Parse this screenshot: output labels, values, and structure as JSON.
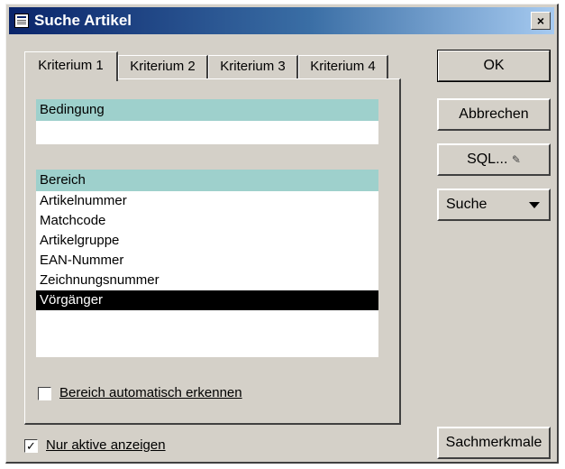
{
  "window": {
    "title": "Suche Artikel",
    "close_glyph": "×"
  },
  "tabs": [
    {
      "label": "Kriterium 1",
      "active": true
    },
    {
      "label": "Kriterium 2",
      "active": false
    },
    {
      "label": "Kriterium 3",
      "active": false
    },
    {
      "label": "Kriterium 4",
      "active": false
    }
  ],
  "bedingung": {
    "header": "Bedingung",
    "value": ""
  },
  "bereich": {
    "header": "Bereich",
    "items": [
      {
        "label": "Artikelnummer",
        "selected": false
      },
      {
        "label": "Matchcode",
        "selected": false
      },
      {
        "label": "Artikelgruppe",
        "selected": false
      },
      {
        "label": "EAN-Nummer",
        "selected": false
      },
      {
        "label": "Zeichnungsnummer",
        "selected": false
      },
      {
        "label": "Vörgänger",
        "selected": true
      }
    ],
    "auto_detect": {
      "label": "Bereich automatisch erkennen",
      "checked": false
    }
  },
  "only_active": {
    "label": "Nur aktive anzeigen",
    "checked": true
  },
  "buttons": {
    "ok": "OK",
    "cancel": "Abbrechen",
    "sql": "SQL...",
    "search": "Suche",
    "sachmerkmale": "Sachmerkmale"
  },
  "icons": {
    "sql_icon": "✎",
    "checkmark": "✓"
  },
  "colors": {
    "title_gradient_start": "#0a246a",
    "header_teal": "#9ed0cc",
    "selection": "#000000"
  }
}
